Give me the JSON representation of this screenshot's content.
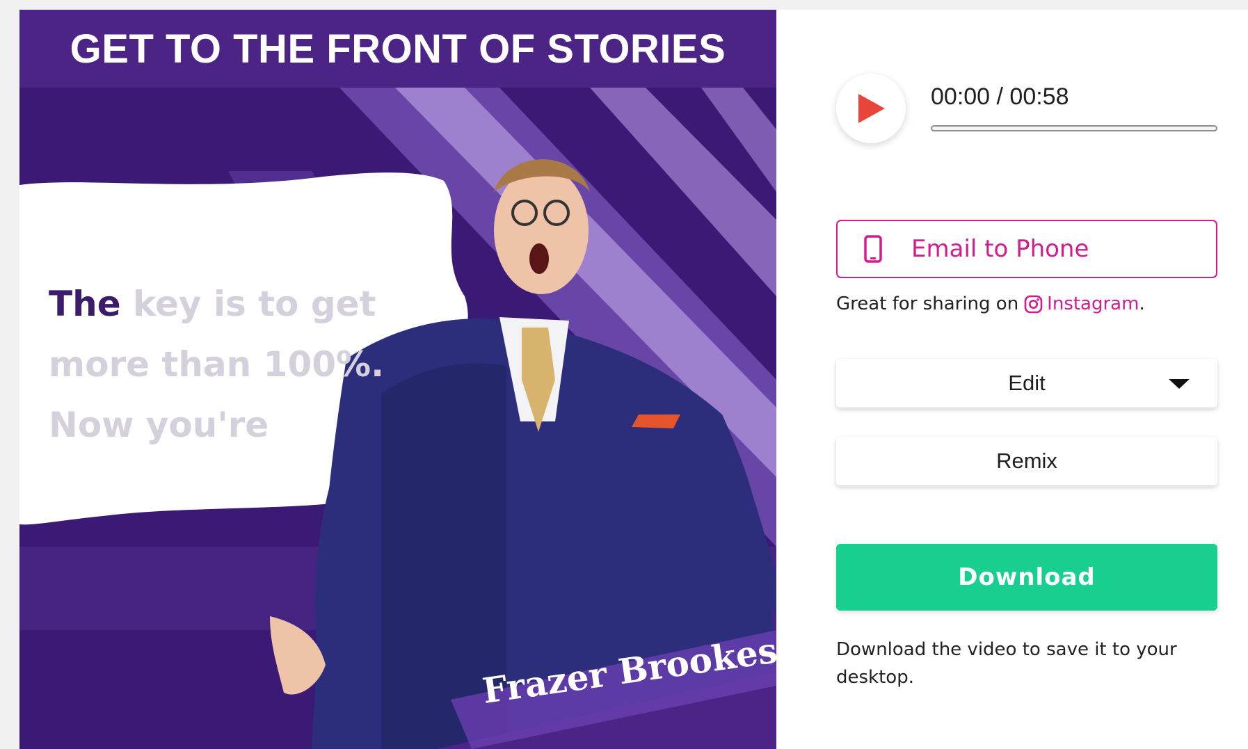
{
  "preview": {
    "title": "GET TO THE FRONT OF STORIES",
    "caption": {
      "highlight": "The",
      "rest_line1": " key is to get",
      "line2": "more than 100%.",
      "line3": "Now you're"
    },
    "presenter_name": "Frazer Brookes",
    "colors": {
      "header_bg": "#4b2486",
      "art_bg": "#3b1a75"
    }
  },
  "player": {
    "play_icon": "play-icon",
    "time_readout": "00:00 / 00:58",
    "progress_fraction": 0
  },
  "actions": {
    "email_label": "Email to Phone",
    "email_icon": "phone-icon",
    "share_note_prefix": "Great for sharing on",
    "share_link_icon": "instagram-icon",
    "share_link_label": "Instagram",
    "share_note_suffix": ".",
    "edit_label": "Edit",
    "remix_label": "Remix",
    "download_label": "Download",
    "download_note": "Download the video to save it to your desktop."
  },
  "colors": {
    "accent_pink": "#d31c8d",
    "play_red": "#e8453c",
    "download_green": "#18cf8f"
  }
}
